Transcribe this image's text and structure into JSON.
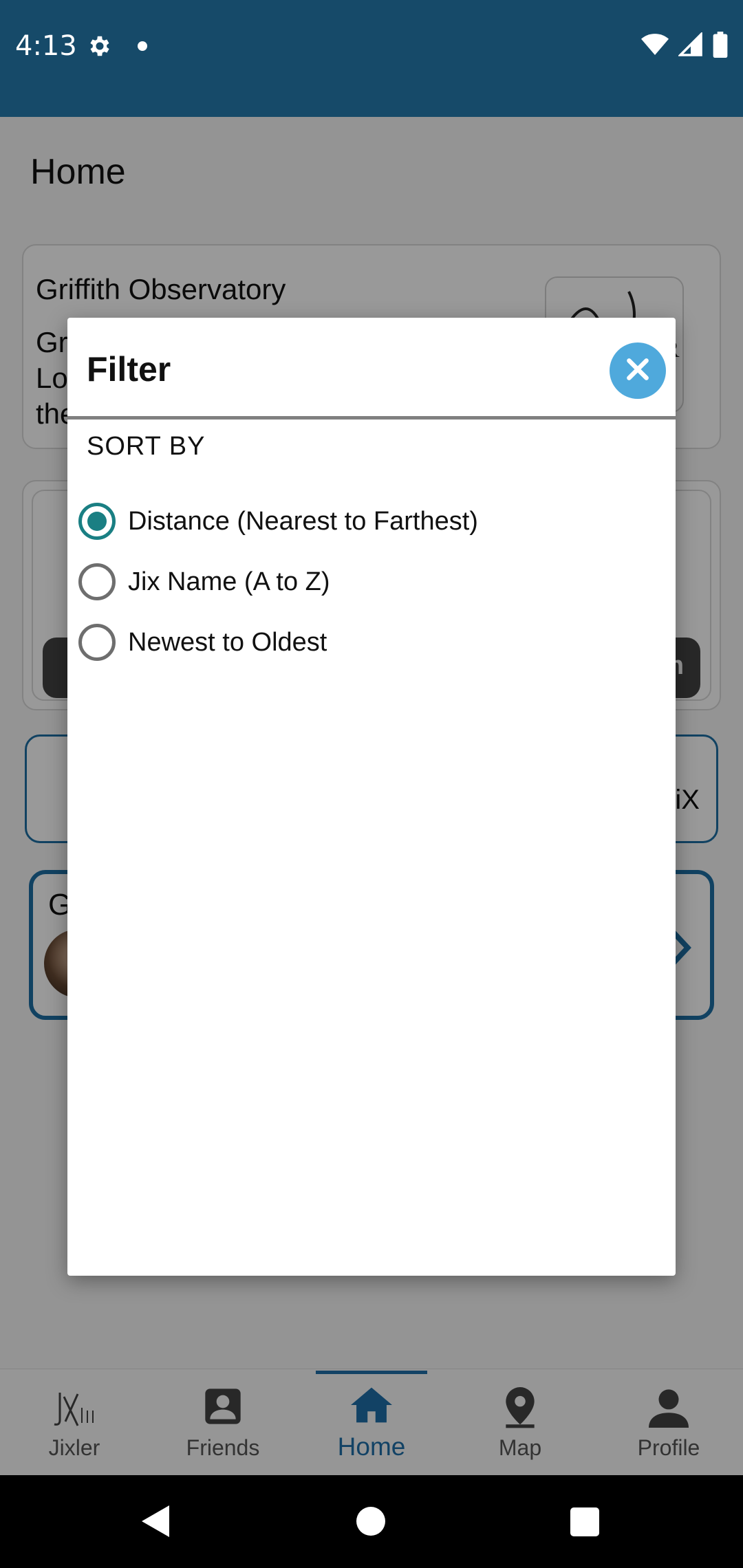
{
  "status_bar": {
    "time": "4:13",
    "icons": [
      "settings-icon",
      "notification-dot-icon",
      "wifi-icon",
      "cellular-icon",
      "battery-icon"
    ]
  },
  "page": {
    "title": "Home",
    "card_a": {
      "name": "Griffith Observatory",
      "desc_fragment": "Gr\nLo\nthe",
      "logo_partial_text": "ER"
    },
    "card_b": {
      "pill_right_text": "m"
    },
    "card_c": {
      "tail_text": "iX"
    },
    "card_d": {
      "initial": "G"
    }
  },
  "modal": {
    "title": "Filter",
    "close_icon": "close-icon",
    "section_label": "SORT BY",
    "options": [
      {
        "label": "Distance (Nearest to Farthest)",
        "selected": true
      },
      {
        "label": "Jix Name (A to Z)",
        "selected": false
      },
      {
        "label": "Newest to Oldest",
        "selected": false
      }
    ],
    "accent_color": "#1a7f83",
    "close_color": "#4fa9dc"
  },
  "bottom_nav": {
    "items": [
      {
        "label": "Jixler",
        "icon": "jixler-logo-icon"
      },
      {
        "label": "Friends",
        "icon": "friends-icon"
      },
      {
        "label": "Home",
        "icon": "home-icon",
        "active": true
      },
      {
        "label": "Map",
        "icon": "map-pin-icon"
      },
      {
        "label": "Profile",
        "icon": "profile-icon"
      }
    ],
    "active_color": "#1e6fa8"
  },
  "colors": {
    "status_bar": "#164a69",
    "card_border_blue": "#1d6fa3"
  }
}
